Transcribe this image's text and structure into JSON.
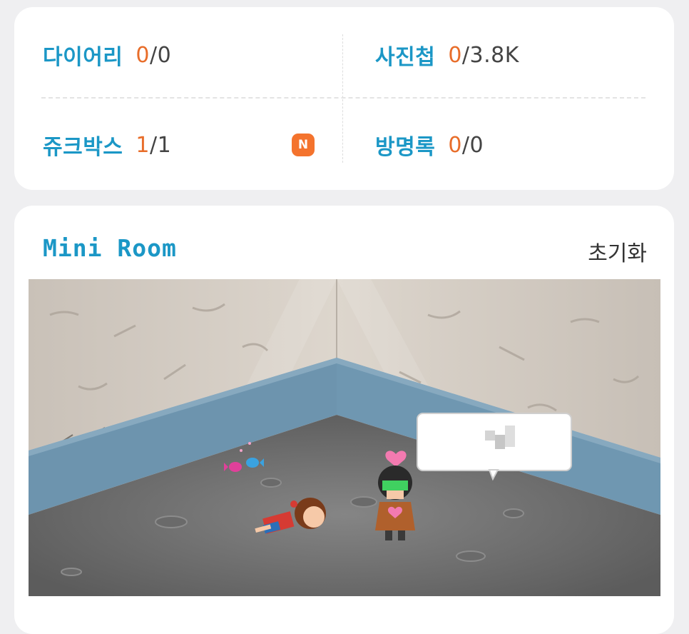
{
  "stats": {
    "diary": {
      "label": "다이어리",
      "current": "0",
      "total": "/0"
    },
    "album": {
      "label": "사진첩",
      "current": "0",
      "total": "/3.8K"
    },
    "jukebox": {
      "label": "쥬크박스",
      "current": "1",
      "total": "/1",
      "badge": "N"
    },
    "guestbook": {
      "label": "방명록",
      "current": "0",
      "total": "/0"
    }
  },
  "mini_room": {
    "title": "Mini Room",
    "reset_label": "초기화"
  },
  "colors": {
    "accent_blue": "#1b97c6",
    "accent_orange": "#e86d2a",
    "badge_orange": "#f4732d"
  }
}
